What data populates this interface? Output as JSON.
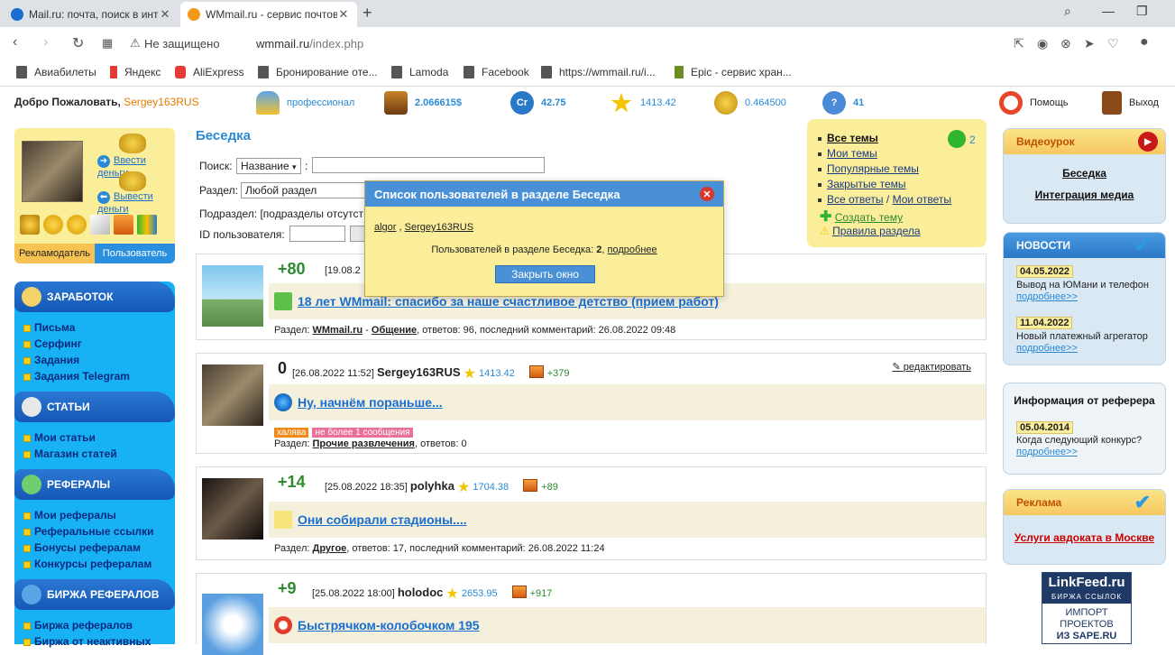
{
  "browser": {
    "tabs": [
      {
        "title": "Mail.ru: почта, поиск в инте",
        "active": false
      },
      {
        "title": "WMmail.ru - сервис почтовых",
        "active": true
      }
    ],
    "new_tab": "+",
    "insecure_label": "Не защищено",
    "url_host": "wmmail.ru",
    "url_path": "/index.php",
    "bookmarks": [
      "Авиабилеты",
      "Яндекс",
      "AliExpress",
      "Бронирование оте...",
      "Lamoda",
      "Facebook",
      "https://wmmail.ru/i...",
      "Epic - сервис хран..."
    ]
  },
  "topbar": {
    "welcome": "Добро Пожаловать,",
    "username": "Sergey163RUS",
    "level": "профессионал",
    "balance": "2.066615$",
    "credits": "42.75",
    "rating": "1413.42",
    "coins": "0.464500",
    "questions": "41",
    "help": "Помощь",
    "exit": "Выход"
  },
  "userbox": {
    "deposit": "Ввести деньги",
    "withdraw": "Вывести деньги",
    "tab_advertiser": "Рекламодатель",
    "tab_user": "Пользователь"
  },
  "leftnav": {
    "sections": [
      {
        "title": "ЗАРАБОТОК",
        "items": [
          "Письма",
          "Серфинг",
          "Задания",
          "Задания Telegram"
        ]
      },
      {
        "title": "СТАТЬИ",
        "items": [
          "Мои статьи",
          "Магазин статей"
        ]
      },
      {
        "title": "РЕФЕРАЛЫ",
        "items": [
          "Мои рефералы",
          "Реферальные ссылки",
          "Бонусы рефералам",
          "Конкурсы рефералам"
        ]
      },
      {
        "title": "БИРЖА РЕФЕРАЛОВ",
        "items": [
          "Биржа рефералов",
          "Биржа от неактивных"
        ]
      }
    ]
  },
  "main": {
    "title": "Беседка",
    "search_label": "Поиск:",
    "search_select": "Название",
    "section_label": "Раздел:",
    "section_value": "Любой раздел",
    "subsection_label": "Подраздел:",
    "subsection_value": "[подразделы отсутст",
    "userid_label": "ID пользователя:",
    "posts": [
      {
        "score": "+80",
        "date": "[19.08.2",
        "title": "18 лет WMmail: спасибо за наше счастливое детство (прием работ)",
        "info_prefix": "Раздел:",
        "section": "WMmail.ru",
        "subsection": "Общение",
        "info_rest": ", ответов: 96, последний комментарий: 26.08.2022 09:48"
      },
      {
        "score": "0",
        "date": "[26.08.2022 11:52]",
        "author": "Sergey163RUS",
        "rating": "1413.42",
        "bonus": "+379",
        "edit": "редактировать",
        "title": "Ну, начнём пораньше...",
        "tag1": "халява",
        "tag2": "не более 1 сообщения",
        "info_prefix": "Раздел:",
        "section": "Прочие развлечения",
        "info_rest": ", ответов: 0"
      },
      {
        "score": "+14",
        "date": "[25.08.2022 18:35]",
        "author": "polyhka",
        "rating": "1704.38",
        "bonus": "+89",
        "title": "Они собирали стадионы....",
        "info_prefix": "Раздел:",
        "section": "Другое",
        "info_rest": ", ответов: 17, последний комментарий: 26.08.2022 11:24"
      },
      {
        "score": "+9",
        "date": "[25.08.2022 18:00]",
        "author": "holodoc",
        "rating": "2653.95",
        "bonus": "+917",
        "title": "Быстрячком-колобочком 195"
      }
    ]
  },
  "popup": {
    "title": "Список пользователей в разделе Беседка",
    "user1": "algor",
    "sep": " , ",
    "user2": "Sergey163RUS",
    "count_text": "Пользователей в разделе Беседка:",
    "count": "2",
    "more": "подробнее",
    "close_button": "Закрыть окно"
  },
  "themes": {
    "items": [
      "Все темы",
      "Мои темы",
      "Популярные темы",
      "Закрытые темы",
      "Все ответы",
      "Мои ответы",
      "Создать тему",
      "Правила раздела"
    ],
    "slash": "/",
    "count": "2"
  },
  "right": {
    "video_title": "Видеоурок",
    "video_links": [
      "Беседка",
      "Интеграция медиа"
    ],
    "news_title": "НОВОСТИ",
    "news": [
      {
        "date": "04.05.2022",
        "text": "Вывод на ЮМани и телефон",
        "more": "подробнее>>"
      },
      {
        "date": "11.04.2022",
        "text": "Новый платежный агрегатор",
        "more": "подробнее>>"
      }
    ],
    "ref_title": "Информация от реферера",
    "ref_date": "05.04.2014",
    "ref_text": "Когда следующий конкурс?",
    "ref_more": "подробнее>>",
    "ad_title": "Реклама",
    "ad_link": "Услуги авдоката в Москве",
    "linkfeed_1": "LinkFeed.ru",
    "linkfeed_2": "БИРЖА ССЫЛОК",
    "linkfeed_3": "ИМПОРТ",
    "linkfeed_4": "ПРОЕКТОВ",
    "linkfeed_5": "ИЗ SAPE.RU"
  },
  "colors": {
    "brand_blue": "#2a8ad6",
    "nav_cyan": "#18b2f4",
    "panel_yellow": "#fbee9b",
    "score_green": "#2e8a2e",
    "accent_orange": "#e07b00"
  }
}
